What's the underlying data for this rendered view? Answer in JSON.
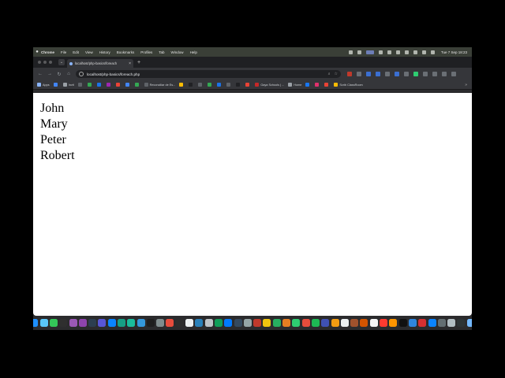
{
  "menubar": {
    "apple": "",
    "items": [
      "Chrome",
      "File",
      "Edit",
      "View",
      "History",
      "Bookmarks",
      "Profiles",
      "Tab",
      "Window",
      "Help"
    ],
    "clock": "Tue 7 Sep 18:23"
  },
  "tab": {
    "title": "localhost/php-basics/foreach",
    "close": "×",
    "new": "+"
  },
  "toolbar": {
    "back": "←",
    "forward": "→",
    "reload": "↻",
    "home": "⌂",
    "url": "localhost/php-basics/foreach.php",
    "zoom_icon": "⌕",
    "star_icon": "☆"
  },
  "bookmarks": [
    {
      "label": "Apps",
      "color": "#8ab4f8"
    },
    {
      "label": "",
      "color": "#4285f4"
    },
    {
      "label": "Invit",
      "color": "#9aa0a6"
    },
    {
      "label": "",
      "color": "#5f6368"
    },
    {
      "label": "",
      "color": "#34a853"
    },
    {
      "label": "",
      "color": "#1a73e8"
    },
    {
      "label": "",
      "color": "#9c27b0"
    },
    {
      "label": "",
      "color": "#ea4335"
    },
    {
      "label": "",
      "color": "#4285f4"
    },
    {
      "label": "",
      "color": "#34a853"
    },
    {
      "label": "Reconciliar de Es...",
      "color": "#5f6368"
    },
    {
      "label": "",
      "color": "#fbbc04"
    },
    {
      "label": "",
      "color": "#202124"
    },
    {
      "label": "",
      "color": "#5f6368"
    },
    {
      "label": "",
      "color": "#34a853"
    },
    {
      "label": "",
      "color": "#1a73e8"
    },
    {
      "label": "",
      "color": "#5f6368"
    },
    {
      "label": "",
      "color": "#202124"
    },
    {
      "label": "",
      "color": "#ea4335"
    },
    {
      "label": "Gaya Schools | ...",
      "color": "#c62828"
    },
    {
      "label": "Home",
      "color": "#9aa0a6"
    },
    {
      "label": "",
      "color": "#1877f2"
    },
    {
      "label": "",
      "color": "#e1306c"
    },
    {
      "label": "",
      "color": "#ea4335"
    },
    {
      "label": "Scrib ClassRoom",
      "color": "#fbbc04"
    }
  ],
  "bookmarks_more": "»",
  "content": {
    "names": [
      "John",
      "Mary",
      "Peter",
      "Robert"
    ]
  },
  "dock_colors": [
    "#3d7be0",
    "#8e8e93",
    "#3478f6",
    "#2ecc71",
    "#1e90ff",
    "#5ac8fa",
    "#34c759",
    "#2f2f2f",
    "#9b59b6",
    "#8e44ad",
    "#2c3e50",
    "#5856d6",
    "#0a84ff",
    "#16a085",
    "#1abc9c",
    "#3498db",
    "#1e1e1e",
    "#7f8c8d",
    "#e74c3c",
    "#2d2d2d",
    "#ecf0f1",
    "#2980b9",
    "#bdc3c7",
    "#0f9d58",
    "#007aff",
    "#34495e",
    "#95a5a6",
    "#c0392b",
    "#f1c40f",
    "#27ae60",
    "#e67e22",
    "#2ecc71",
    "#e74c3c",
    "#1db954",
    "#3f51b5",
    "#f39c12",
    "#ecf0f1",
    "#a0522d",
    "#d35400",
    "#f5f5f5",
    "#ff3b30",
    "#ff9500",
    "#111111",
    "#2e86de",
    "#d63031",
    "#0a84ff",
    "#636e72",
    "#b2bec3",
    "#2d3436",
    "#74b9ff",
    "#27ae60",
    "#f5f6fa",
    "#dfe6e9",
    "#636e72"
  ]
}
